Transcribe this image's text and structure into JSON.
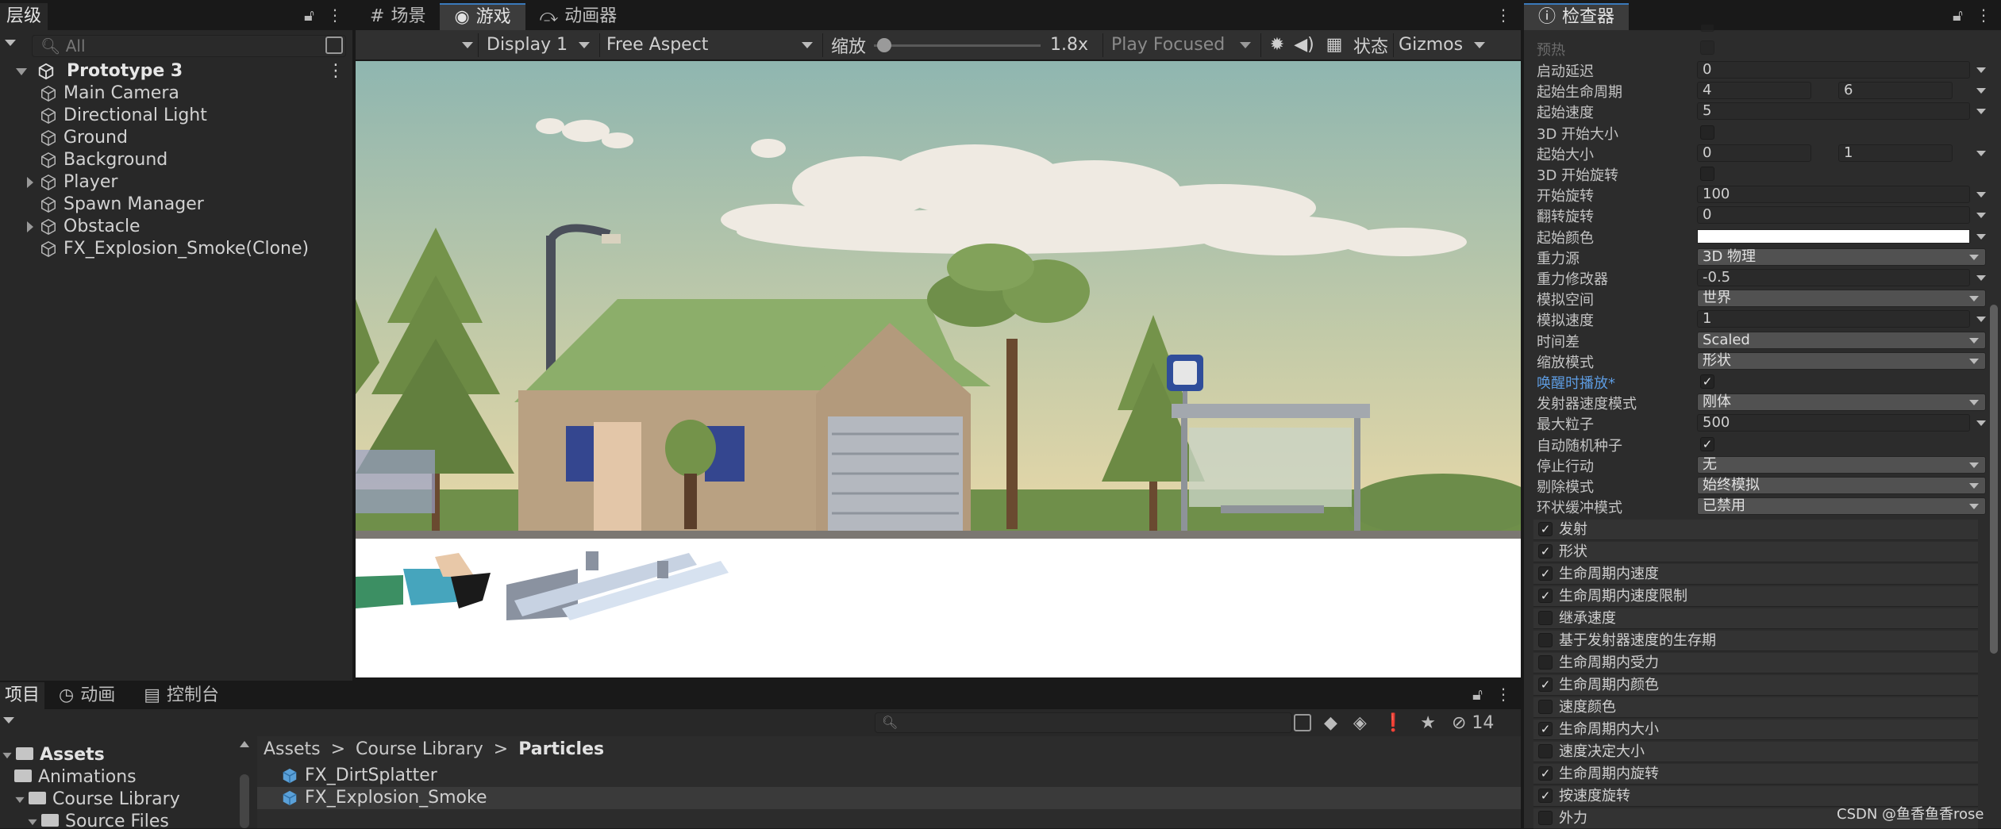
{
  "hierarchy": {
    "tab_label": "层级",
    "search_placeholder": "All",
    "scene": "Prototype 3",
    "items": [
      {
        "label": "Main Camera",
        "expandable": false
      },
      {
        "label": "Directional Light",
        "expandable": false
      },
      {
        "label": "Ground",
        "expandable": false
      },
      {
        "label": "Background",
        "expandable": false
      },
      {
        "label": "Player",
        "expandable": true
      },
      {
        "label": "Spawn Manager",
        "expandable": false
      },
      {
        "label": "Obstacle",
        "expandable": true
      },
      {
        "label": "FX_Explosion_Smoke(Clone)",
        "expandable": false
      }
    ]
  },
  "center_tabs": {
    "scene_label": "场景",
    "game_label": "游戏",
    "animator_label": "动画器"
  },
  "game_toolbar": {
    "display": "Display 1",
    "aspect": "Free Aspect",
    "scale_label": "缩放",
    "scale_value": "1.8x",
    "scale_fraction": 0.02,
    "play_mode": "Play Focused",
    "stats_label": "状态",
    "gizmos_label": "Gizmos"
  },
  "inspector": {
    "tab_label": "检查器",
    "top_faded": [
      "预热"
    ],
    "properties": [
      {
        "label": "启动延迟",
        "type": "field",
        "value": "0"
      },
      {
        "label": "起始生命周期",
        "type": "field2",
        "value": "4",
        "value2": "6"
      },
      {
        "label": "起始速度",
        "type": "field",
        "value": "5"
      },
      {
        "label": "3D 开始大小",
        "type": "check",
        "checked": false
      },
      {
        "label": "起始大小",
        "type": "field2",
        "value": "0",
        "value2": "1"
      },
      {
        "label": "3D 开始旋转",
        "type": "check",
        "checked": false
      },
      {
        "label": "开始旋转",
        "type": "field",
        "value": "100"
      },
      {
        "label": "翻转旋转",
        "type": "field",
        "value": "0"
      },
      {
        "label": "起始颜色",
        "type": "color",
        "value": "#ffffff"
      },
      {
        "label": "重力源",
        "type": "drop",
        "value": "3D 物理"
      },
      {
        "label": "重力修改器",
        "type": "field",
        "value": "-0.5"
      },
      {
        "label": "模拟空间",
        "type": "drop",
        "value": "世界"
      },
      {
        "label": "模拟速度",
        "type": "field",
        "value": "1"
      },
      {
        "label": "时间差",
        "type": "drop",
        "value": "Scaled"
      },
      {
        "label": "缩放模式",
        "type": "drop",
        "value": "形状"
      },
      {
        "label": "唤醒时播放*",
        "type": "check",
        "checked": true,
        "highlight": true
      },
      {
        "label": "发射器速度模式",
        "type": "drop",
        "value": "刚体"
      },
      {
        "label": "最大粒子",
        "type": "field",
        "value": "500"
      },
      {
        "label": "自动随机种子",
        "type": "check",
        "checked": true
      },
      {
        "label": "停止行动",
        "type": "drop",
        "value": "无"
      },
      {
        "label": "剔除模式",
        "type": "drop",
        "value": "始终模拟"
      },
      {
        "label": "环状缓冲模式",
        "type": "drop",
        "value": "已禁用"
      }
    ],
    "modules": [
      {
        "label": "发射",
        "checked": true
      },
      {
        "label": "形状",
        "checked": true
      },
      {
        "label": "生命周期内速度",
        "checked": true
      },
      {
        "label": "生命周期内速度限制",
        "checked": true
      },
      {
        "label": "继承速度",
        "checked": false
      },
      {
        "label": "基于发射器速度的生存期",
        "checked": false
      },
      {
        "label": "生命周期内受力",
        "checked": false
      },
      {
        "label": "生命周期内颜色",
        "checked": true
      },
      {
        "label": "速度颜色",
        "checked": false
      },
      {
        "label": "生命周期内大小",
        "checked": true
      },
      {
        "label": "速度决定大小",
        "checked": false
      },
      {
        "label": "生命周期内旋转",
        "checked": true
      },
      {
        "label": "按速度旋转",
        "checked": true
      },
      {
        "label": "外力",
        "checked": false
      }
    ]
  },
  "bottom": {
    "tabs": [
      "项目",
      "动画",
      "控制台"
    ],
    "hidden_count": "14",
    "tree": [
      {
        "label": "Assets",
        "level": 0,
        "bold": true
      },
      {
        "label": "Animations",
        "level": 1
      },
      {
        "label": "Course Library",
        "level": 1
      },
      {
        "label": "Source Files",
        "level": 2
      }
    ],
    "breadcrumb": [
      "Assets",
      "Course Library",
      "Particles"
    ],
    "files": [
      "FX_DirtSplatter",
      "FX_Explosion_Smoke"
    ]
  },
  "watermark": "CSDN @鱼香鱼香rose"
}
